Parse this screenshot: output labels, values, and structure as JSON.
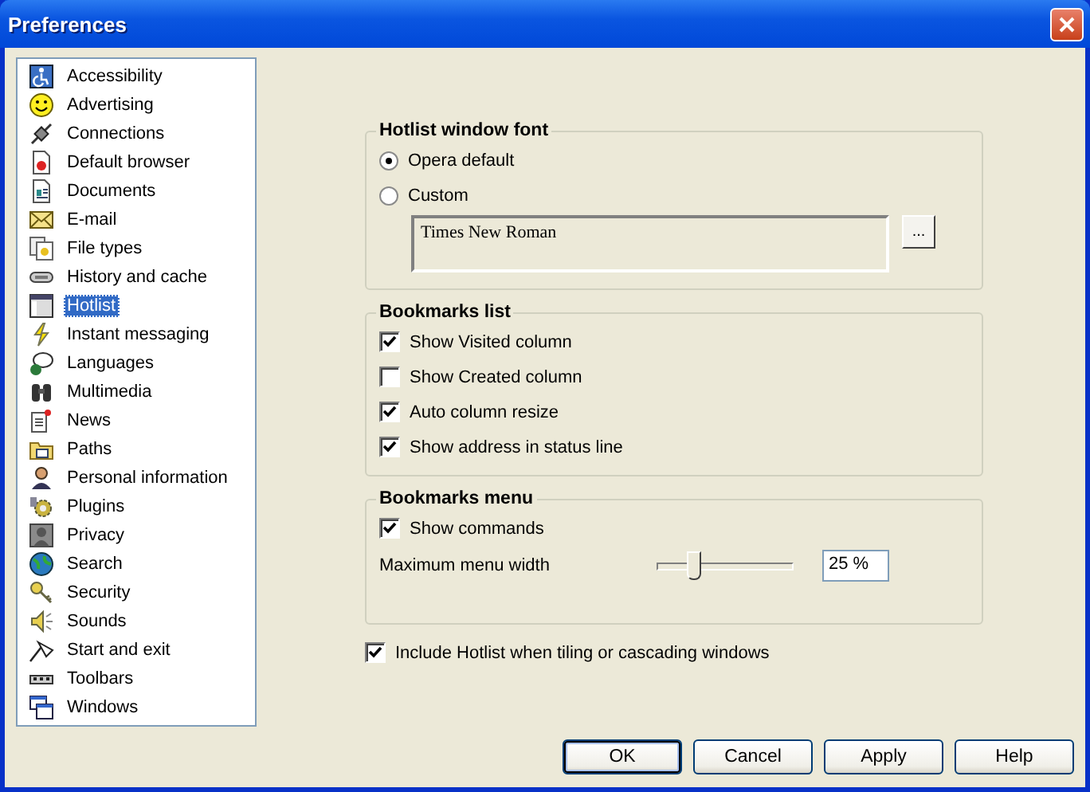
{
  "window": {
    "title": "Preferences"
  },
  "sidebar": {
    "items": [
      {
        "label": "Accessibility",
        "selected": false
      },
      {
        "label": "Advertising",
        "selected": false
      },
      {
        "label": "Connections",
        "selected": false
      },
      {
        "label": "Default browser",
        "selected": false
      },
      {
        "label": "Documents",
        "selected": false
      },
      {
        "label": "E-mail",
        "selected": false
      },
      {
        "label": "File types",
        "selected": false
      },
      {
        "label": "History and cache",
        "selected": false
      },
      {
        "label": "Hotlist",
        "selected": true
      },
      {
        "label": "Instant messaging",
        "selected": false
      },
      {
        "label": "Languages",
        "selected": false
      },
      {
        "label": "Multimedia",
        "selected": false
      },
      {
        "label": "News",
        "selected": false
      },
      {
        "label": "Paths",
        "selected": false
      },
      {
        "label": "Personal information",
        "selected": false
      },
      {
        "label": "Plugins",
        "selected": false
      },
      {
        "label": "Privacy",
        "selected": false
      },
      {
        "label": "Search",
        "selected": false
      },
      {
        "label": "Security",
        "selected": false
      },
      {
        "label": "Sounds",
        "selected": false
      },
      {
        "label": "Start and exit",
        "selected": false
      },
      {
        "label": "Toolbars",
        "selected": false
      },
      {
        "label": "Windows",
        "selected": false
      }
    ]
  },
  "groups": [
    {
      "title": "Hotlist window font",
      "items": [
        {
          "kind": "radio",
          "label": "Opera default",
          "selected": true
        },
        {
          "kind": "radio",
          "label": "Custom",
          "selected": false
        },
        {
          "kind": "font-preview",
          "value": "Times New Roman",
          "button": "..."
        }
      ]
    },
    {
      "title": "Bookmarks list",
      "items": [
        {
          "kind": "checkbox",
          "label": "Show Visited column",
          "checked": true
        },
        {
          "kind": "checkbox",
          "label": "Show Created column",
          "checked": false
        },
        {
          "kind": "checkbox",
          "label": "Auto column resize",
          "checked": true
        },
        {
          "kind": "checkbox",
          "label": "Show address in status line",
          "checked": true
        }
      ]
    },
    {
      "title": "Bookmarks menu",
      "items": [
        {
          "kind": "checkbox",
          "label": "Show commands",
          "checked": true
        },
        {
          "kind": "slider",
          "label": "Maximum menu width",
          "level": 0.25,
          "value": "25 %"
        }
      ]
    }
  ],
  "include_hotlist": {
    "label": "Include Hotlist when tiling or cascading windows",
    "checked": true
  },
  "buttons": [
    {
      "label": "OK",
      "default": true
    },
    {
      "label": "Cancel",
      "default": false
    },
    {
      "label": "Apply",
      "default": false
    },
    {
      "label": "Help",
      "default": false
    }
  ]
}
